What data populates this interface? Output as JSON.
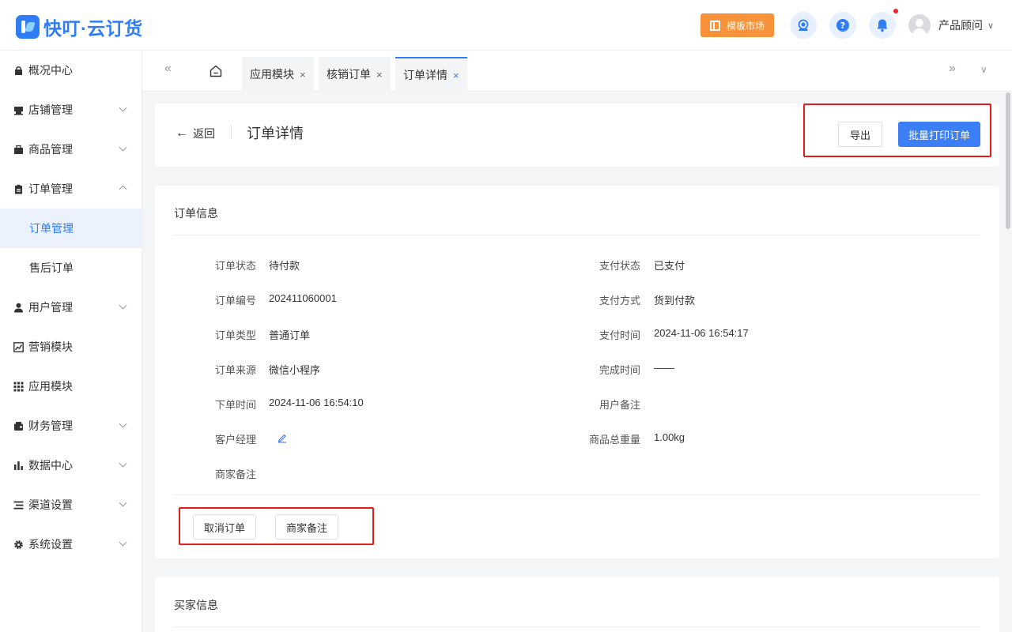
{
  "header": {
    "logo_text": "快叮·云订货",
    "market_label": "模板市场",
    "user_name": "产品顾问",
    "caret": "∨"
  },
  "sidebar": {
    "items": [
      {
        "label": "概况中心",
        "icon": "shop-bag-icon"
      },
      {
        "label": "店铺管理",
        "icon": "store-icon"
      },
      {
        "label": "商品管理",
        "icon": "goods-icon"
      },
      {
        "label": "订单管理",
        "icon": "clipboard-icon"
      },
      {
        "label": "用户管理",
        "icon": "user-icon"
      },
      {
        "label": "营销模块",
        "icon": "chart-line-icon"
      },
      {
        "label": "应用模块",
        "icon": "grid-icon"
      },
      {
        "label": "财务管理",
        "icon": "wallet-icon"
      },
      {
        "label": "数据中心",
        "icon": "bar-chart-icon"
      },
      {
        "label": "渠道设置",
        "icon": "list-icon"
      },
      {
        "label": "系统设置",
        "icon": "gear-icon"
      }
    ],
    "sub_items": [
      {
        "label": "订单管理",
        "active": true
      },
      {
        "label": "售后订单",
        "active": false
      }
    ]
  },
  "tabs": {
    "items": [
      {
        "label": "应用模块",
        "close": "×"
      },
      {
        "label": "核销订单",
        "close": "×"
      },
      {
        "label": "订单详情",
        "close": "×"
      }
    ],
    "left_arrow": "«",
    "right_arrow": "»",
    "dropdown": "∨"
  },
  "topbar": {
    "back_label": "返回",
    "back_arrow": "←",
    "title": "订单详情",
    "export_label": "导出",
    "print_label": "批量打印订单"
  },
  "order_info": {
    "section_title": "订单信息",
    "left": [
      {
        "label": "订单状态",
        "value": "待付款"
      },
      {
        "label": "订单编号",
        "value": "202411060001"
      },
      {
        "label": "订单类型",
        "value": "普通订单"
      },
      {
        "label": "订单来源",
        "value": "微信小程序"
      },
      {
        "label": "下单时间",
        "value": "2024-11-06 16:54:10"
      },
      {
        "label": "客户经理",
        "value": ""
      },
      {
        "label": "商家备注",
        "value": ""
      }
    ],
    "right": [
      {
        "label": "支付状态",
        "value": "已支付"
      },
      {
        "label": "支付方式",
        "value": "货到付款"
      },
      {
        "label": "支付时间",
        "value": "2024-11-06 16:54:17"
      },
      {
        "label": "完成时间",
        "value": "——"
      },
      {
        "label": "用户备注",
        "value": ""
      },
      {
        "label": "商品总重量",
        "value": "1.00kg"
      }
    ],
    "cancel_label": "取消订单",
    "remark_label": "商家备注"
  },
  "buyer_info": {
    "section_title": "买家信息"
  },
  "colors": {
    "primary": "#3c7ef6",
    "accent_orange": "#f7923a",
    "highlight_red": "#e21b1b"
  }
}
